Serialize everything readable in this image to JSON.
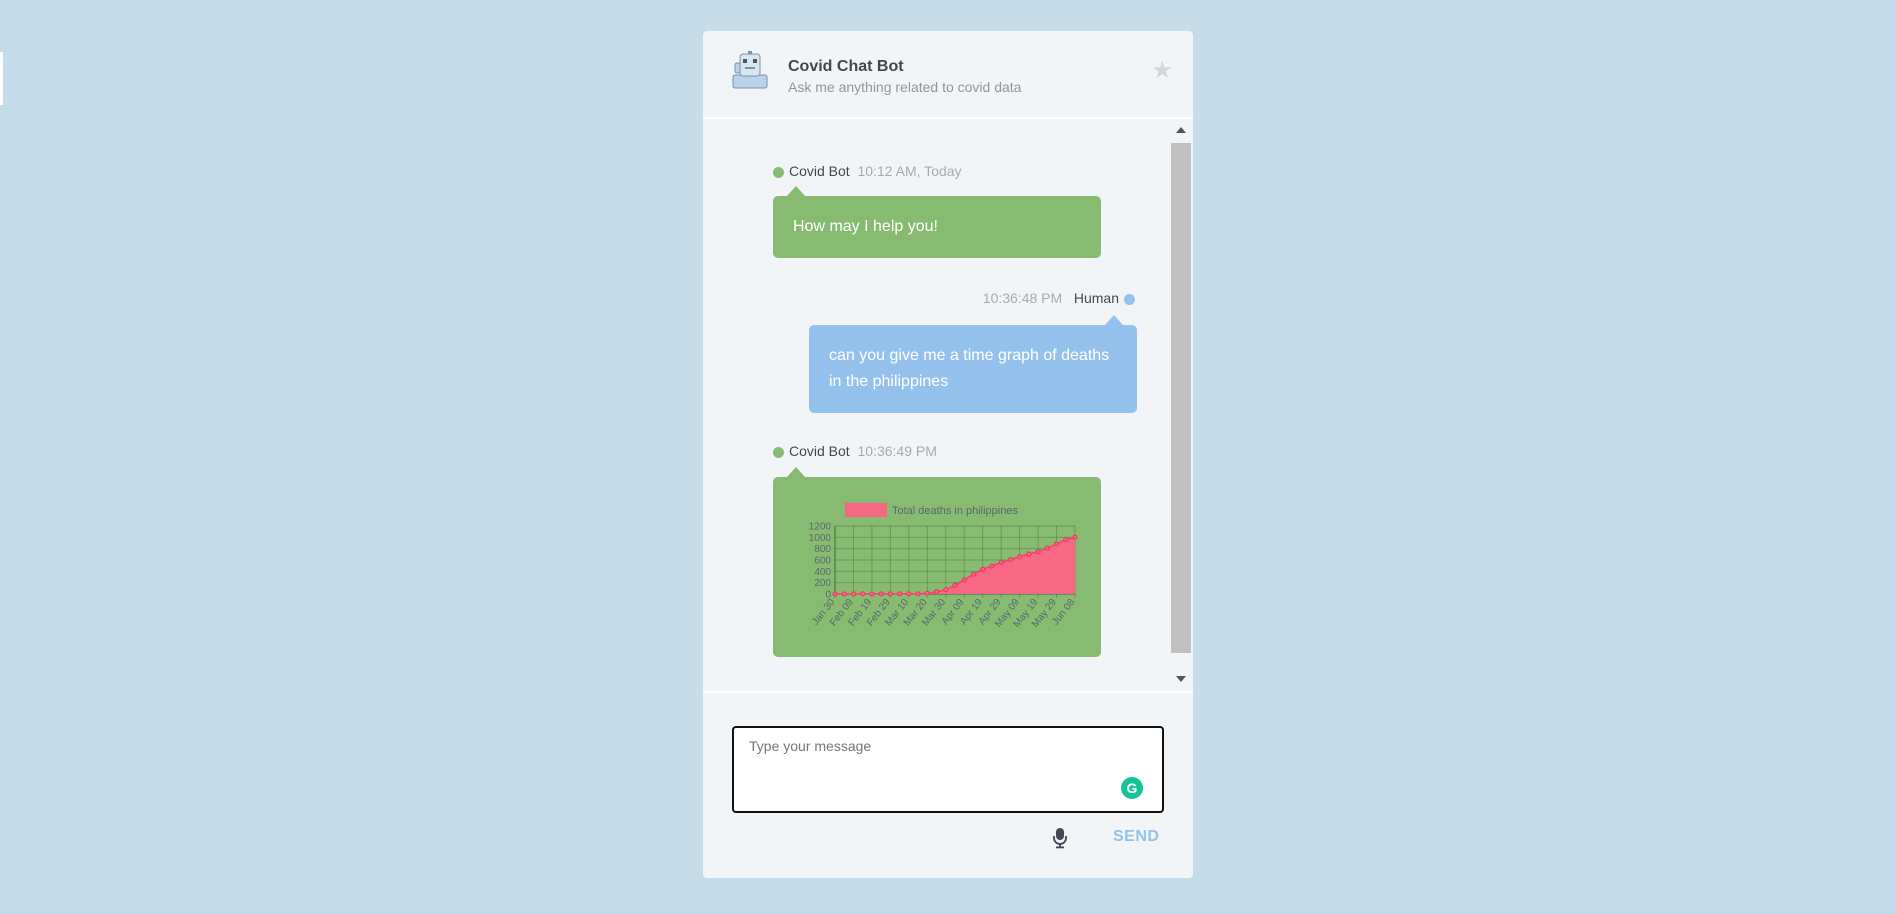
{
  "header": {
    "title": "Covid Chat Bot",
    "subtitle": "Ask me anything related to covid data"
  },
  "messages": [
    {
      "sender": "Covid Bot",
      "time": "10:12 AM, Today",
      "text": "How may I help you!"
    },
    {
      "sender": "Human",
      "time": "10:36:48 PM",
      "text": "can you give me a time graph of deaths in the philippines"
    },
    {
      "sender": "Covid Bot",
      "time": "10:36:49 PM",
      "text": ""
    }
  ],
  "composer": {
    "placeholder": "Type your message",
    "send_label": "SEND",
    "grammarly_label": "G"
  },
  "colors": {
    "page_bg": "#c5dceb",
    "bot_bubble": "#86bb71",
    "human_bubble": "#94c2ed",
    "series": "#ff6384"
  },
  "icons": [
    "robot-avatar-icon",
    "star-icon",
    "microphone-icon",
    "grammarly-icon"
  ],
  "chart_data": {
    "type": "area",
    "legend": "Total deaths in philippines",
    "x": [
      "Jan 30",
      "Feb 04",
      "Feb 09",
      "Feb 14",
      "Feb 19",
      "Feb 24",
      "Feb 29",
      "Mar 05",
      "Mar 10",
      "Mar 15",
      "Mar 20",
      "Mar 25",
      "Mar 30",
      "Apr 04",
      "Apr 09",
      "Apr 14",
      "Apr 19",
      "Apr 24",
      "Apr 29",
      "May 04",
      "May 09",
      "May 14",
      "May 19",
      "May 24",
      "May 29",
      "Jun 03",
      "Jun 08"
    ],
    "tick_labels": [
      "Jan 30",
      "Feb 09",
      "Feb 19",
      "Feb 29",
      "Mar 10",
      "Mar 20",
      "Mar 30",
      "Apr 09",
      "Apr 19",
      "Apr 29",
      "May 09",
      "May 19",
      "May 29",
      "Jun 08"
    ],
    "values": [
      0,
      0,
      1,
      1,
      1,
      1,
      1,
      1,
      1,
      2,
      15,
      38,
      78,
      152,
      247,
      349,
      437,
      494,
      558,
      607,
      658,
      706,
      747,
      810,
      884,
      960,
      1000
    ],
    "yticks": [
      0,
      200,
      400,
      600,
      800,
      1000,
      1200
    ],
    "ylim": [
      0,
      1200
    ],
    "grid": true,
    "legend_position": "top"
  }
}
